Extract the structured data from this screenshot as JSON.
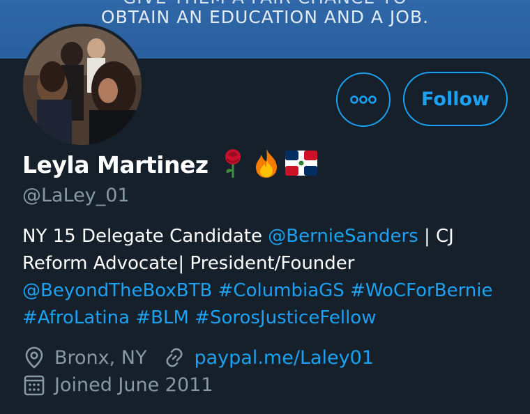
{
  "banner": {
    "line1": "GIVE THEM A FAIR CHANCE TO",
    "line2": "OBTAIN AN EDUCATION AND A JOB."
  },
  "profile": {
    "name": "Leyla Martinez",
    "emojis": [
      "rose",
      "fire",
      "flag-dominican-republic"
    ],
    "handle": "@LaLey_01",
    "bio": {
      "t1": "NY 15 Delegate Candidate ",
      "mention1": "@BernieSanders",
      "t2": "  | CJ Reform Advocate| President/Founder ",
      "mention2": "@BeyondTheBoxBTB",
      "tag1": "#ColumbiaGS",
      "tag2": "#WoCForBernie",
      "tag3": "#AfroLatina",
      "tag4": "#BLM",
      "tag5": "#SorosJusticeFellow"
    },
    "location": "Bronx, NY",
    "website": "paypal.me/Laley01",
    "joined": "Joined June 2011"
  },
  "actions": {
    "more_icon": "more-icon",
    "follow_label": "Follow"
  },
  "colors": {
    "background": "#15202b",
    "accent": "#1da1f2",
    "muted": "#8899a6",
    "banner": "#2f67a8"
  }
}
